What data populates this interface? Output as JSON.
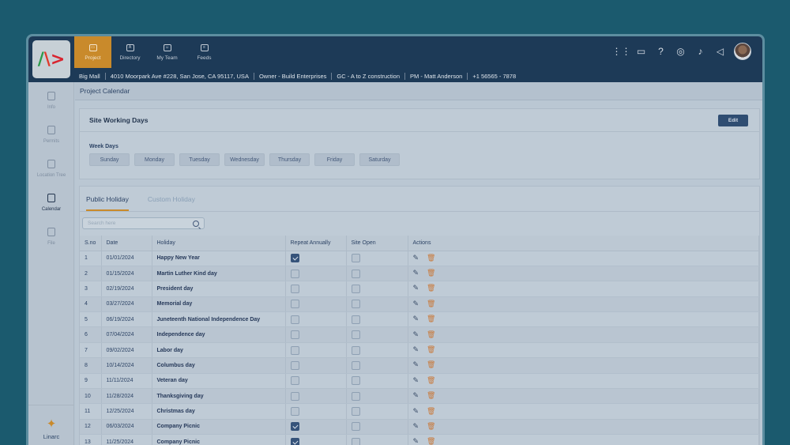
{
  "nav": [
    {
      "label": "Project",
      "glyph": "▭",
      "active": true,
      "icon": "folder-icon"
    },
    {
      "label": "Directory",
      "glyph": "A",
      "active": false,
      "icon": "directory-icon"
    },
    {
      "label": "My Team",
      "glyph": "☺",
      "active": false,
      "icon": "team-icon"
    },
    {
      "label": "Feeds",
      "glyph": "≡",
      "active": false,
      "icon": "feeds-icon"
    }
  ],
  "header_actions": [
    "apps-grid-icon",
    "chat-icon",
    "help-icon",
    "support-icon",
    "bell-icon",
    "megaphone-icon"
  ],
  "info": [
    "Big Mall",
    "4010 Moorpark Ave #228, San Jose, CA 95117, USA",
    "Owner - Build Enterprises",
    "GC - A to Z construction",
    "PM -  Matt Anderson",
    "+1 56565 - 7878"
  ],
  "sidebar": [
    {
      "label": "Info",
      "icon": "info-icon",
      "active": false
    },
    {
      "label": "Permits",
      "icon": "permits-icon",
      "active": false
    },
    {
      "label": "Location Tree",
      "icon": "location-tree-icon",
      "active": false
    },
    {
      "label": "Calendar",
      "icon": "calendar-icon",
      "active": true
    },
    {
      "label": "File",
      "icon": "file-icon",
      "active": false
    }
  ],
  "brand": "Linarc",
  "page_title": "Project Calendar",
  "working_days": {
    "title": "Site Working Days",
    "edit_label": "Edit",
    "week_days_label": "Week Days",
    "days": [
      "Sunday",
      "Monday",
      "Tuesday",
      "Wednesday",
      "Thursday",
      "Friday",
      "Saturday"
    ]
  },
  "tabs": [
    "Public Holiday",
    "Custom Holiday"
  ],
  "search_placeholder": "Search here",
  "table": {
    "headers": [
      "S.no",
      "Date",
      "Holiday",
      "Repeat Annually",
      "Site Open",
      "Actions"
    ],
    "rows": [
      {
        "sno": "1",
        "date": "01/01/2024",
        "holiday": "Happy New Year",
        "repeat": true,
        "open": false
      },
      {
        "sno": "2",
        "date": "01/15/2024",
        "holiday": "Martin Luther Kind day",
        "repeat": false,
        "open": false
      },
      {
        "sno": "3",
        "date": "02/19/2024",
        "holiday": "President day",
        "repeat": false,
        "open": false
      },
      {
        "sno": "4",
        "date": "03/27/2024",
        "holiday": "Memorial day",
        "repeat": false,
        "open": false
      },
      {
        "sno": "5",
        "date": "06/19/2024",
        "holiday": "Juneteenth National Independence Day",
        "repeat": false,
        "open": false
      },
      {
        "sno": "6",
        "date": "07/04/2024",
        "holiday": "Independence day",
        "repeat": false,
        "open": false
      },
      {
        "sno": "7",
        "date": "09/02/2024",
        "holiday": "Labor day",
        "repeat": false,
        "open": false
      },
      {
        "sno": "8",
        "date": "10/14/2024",
        "holiday": "Columbus day",
        "repeat": false,
        "open": false
      },
      {
        "sno": "9",
        "date": "11/11/2024",
        "holiday": "Veteran day",
        "repeat": false,
        "open": false
      },
      {
        "sno": "10",
        "date": "11/28/2024",
        "holiday": "Thanksgiving day",
        "repeat": false,
        "open": false
      },
      {
        "sno": "11",
        "date": "12/25/2024",
        "holiday": "Christmas day",
        "repeat": false,
        "open": false
      },
      {
        "sno": "12",
        "date": "06/03/2024",
        "holiday": "Company Picnic",
        "repeat": true,
        "open": false
      },
      {
        "sno": "13",
        "date": "11/25/2024",
        "holiday": "Company Picnic",
        "repeat": true,
        "open": false
      }
    ]
  },
  "colors": {
    "accent": "#c98a2b",
    "header": "#1d3a57",
    "background": "#1b5a6e",
    "delete": "#c9793a"
  }
}
